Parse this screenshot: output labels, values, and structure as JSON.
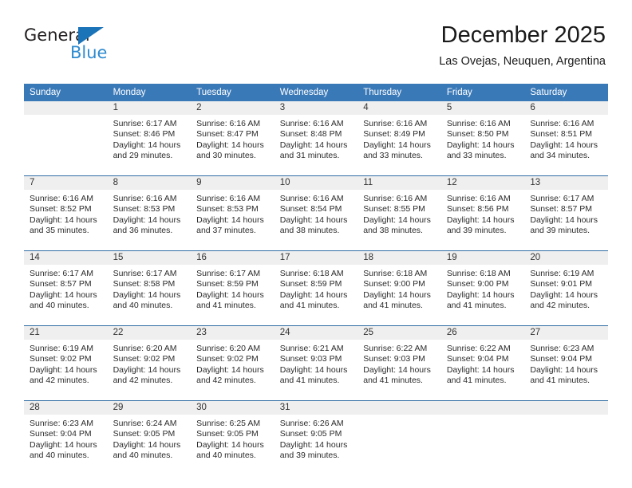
{
  "brand": {
    "name_top": "General",
    "name_bottom": "Blue",
    "accent_color": "#2e8bd0",
    "triangle_color": "#1b73b8"
  },
  "header": {
    "title": "December 2025",
    "subtitle": "Las Ovejas, Neuquen, Argentina"
  },
  "calendar": {
    "header_bg": "#3a79b8",
    "daynum_bg": "#efefef",
    "weekday_headers": [
      "Sunday",
      "Monday",
      "Tuesday",
      "Wednesday",
      "Thursday",
      "Friday",
      "Saturday"
    ],
    "weeks": [
      [
        {
          "day": "",
          "sunrise": "",
          "sunset": "",
          "daylight_line1": "",
          "daylight_line2": ""
        },
        {
          "day": "1",
          "sunrise": "Sunrise: 6:17 AM",
          "sunset": "Sunset: 8:46 PM",
          "daylight_line1": "Daylight: 14 hours",
          "daylight_line2": "and 29 minutes."
        },
        {
          "day": "2",
          "sunrise": "Sunrise: 6:16 AM",
          "sunset": "Sunset: 8:47 PM",
          "daylight_line1": "Daylight: 14 hours",
          "daylight_line2": "and 30 minutes."
        },
        {
          "day": "3",
          "sunrise": "Sunrise: 6:16 AM",
          "sunset": "Sunset: 8:48 PM",
          "daylight_line1": "Daylight: 14 hours",
          "daylight_line2": "and 31 minutes."
        },
        {
          "day": "4",
          "sunrise": "Sunrise: 6:16 AM",
          "sunset": "Sunset: 8:49 PM",
          "daylight_line1": "Daylight: 14 hours",
          "daylight_line2": "and 33 minutes."
        },
        {
          "day": "5",
          "sunrise": "Sunrise: 6:16 AM",
          "sunset": "Sunset: 8:50 PM",
          "daylight_line1": "Daylight: 14 hours",
          "daylight_line2": "and 33 minutes."
        },
        {
          "day": "6",
          "sunrise": "Sunrise: 6:16 AM",
          "sunset": "Sunset: 8:51 PM",
          "daylight_line1": "Daylight: 14 hours",
          "daylight_line2": "and 34 minutes."
        }
      ],
      [
        {
          "day": "7",
          "sunrise": "Sunrise: 6:16 AM",
          "sunset": "Sunset: 8:52 PM",
          "daylight_line1": "Daylight: 14 hours",
          "daylight_line2": "and 35 minutes."
        },
        {
          "day": "8",
          "sunrise": "Sunrise: 6:16 AM",
          "sunset": "Sunset: 8:53 PM",
          "daylight_line1": "Daylight: 14 hours",
          "daylight_line2": "and 36 minutes."
        },
        {
          "day": "9",
          "sunrise": "Sunrise: 6:16 AM",
          "sunset": "Sunset: 8:53 PM",
          "daylight_line1": "Daylight: 14 hours",
          "daylight_line2": "and 37 minutes."
        },
        {
          "day": "10",
          "sunrise": "Sunrise: 6:16 AM",
          "sunset": "Sunset: 8:54 PM",
          "daylight_line1": "Daylight: 14 hours",
          "daylight_line2": "and 38 minutes."
        },
        {
          "day": "11",
          "sunrise": "Sunrise: 6:16 AM",
          "sunset": "Sunset: 8:55 PM",
          "daylight_line1": "Daylight: 14 hours",
          "daylight_line2": "and 38 minutes."
        },
        {
          "day": "12",
          "sunrise": "Sunrise: 6:16 AM",
          "sunset": "Sunset: 8:56 PM",
          "daylight_line1": "Daylight: 14 hours",
          "daylight_line2": "and 39 minutes."
        },
        {
          "day": "13",
          "sunrise": "Sunrise: 6:17 AM",
          "sunset": "Sunset: 8:57 PM",
          "daylight_line1": "Daylight: 14 hours",
          "daylight_line2": "and 39 minutes."
        }
      ],
      [
        {
          "day": "14",
          "sunrise": "Sunrise: 6:17 AM",
          "sunset": "Sunset: 8:57 PM",
          "daylight_line1": "Daylight: 14 hours",
          "daylight_line2": "and 40 minutes."
        },
        {
          "day": "15",
          "sunrise": "Sunrise: 6:17 AM",
          "sunset": "Sunset: 8:58 PM",
          "daylight_line1": "Daylight: 14 hours",
          "daylight_line2": "and 40 minutes."
        },
        {
          "day": "16",
          "sunrise": "Sunrise: 6:17 AM",
          "sunset": "Sunset: 8:59 PM",
          "daylight_line1": "Daylight: 14 hours",
          "daylight_line2": "and 41 minutes."
        },
        {
          "day": "17",
          "sunrise": "Sunrise: 6:18 AM",
          "sunset": "Sunset: 8:59 PM",
          "daylight_line1": "Daylight: 14 hours",
          "daylight_line2": "and 41 minutes."
        },
        {
          "day": "18",
          "sunrise": "Sunrise: 6:18 AM",
          "sunset": "Sunset: 9:00 PM",
          "daylight_line1": "Daylight: 14 hours",
          "daylight_line2": "and 41 minutes."
        },
        {
          "day": "19",
          "sunrise": "Sunrise: 6:18 AM",
          "sunset": "Sunset: 9:00 PM",
          "daylight_line1": "Daylight: 14 hours",
          "daylight_line2": "and 41 minutes."
        },
        {
          "day": "20",
          "sunrise": "Sunrise: 6:19 AM",
          "sunset": "Sunset: 9:01 PM",
          "daylight_line1": "Daylight: 14 hours",
          "daylight_line2": "and 42 minutes."
        }
      ],
      [
        {
          "day": "21",
          "sunrise": "Sunrise: 6:19 AM",
          "sunset": "Sunset: 9:02 PM",
          "daylight_line1": "Daylight: 14 hours",
          "daylight_line2": "and 42 minutes."
        },
        {
          "day": "22",
          "sunrise": "Sunrise: 6:20 AM",
          "sunset": "Sunset: 9:02 PM",
          "daylight_line1": "Daylight: 14 hours",
          "daylight_line2": "and 42 minutes."
        },
        {
          "day": "23",
          "sunrise": "Sunrise: 6:20 AM",
          "sunset": "Sunset: 9:02 PM",
          "daylight_line1": "Daylight: 14 hours",
          "daylight_line2": "and 42 minutes."
        },
        {
          "day": "24",
          "sunrise": "Sunrise: 6:21 AM",
          "sunset": "Sunset: 9:03 PM",
          "daylight_line1": "Daylight: 14 hours",
          "daylight_line2": "and 41 minutes."
        },
        {
          "day": "25",
          "sunrise": "Sunrise: 6:22 AM",
          "sunset": "Sunset: 9:03 PM",
          "daylight_line1": "Daylight: 14 hours",
          "daylight_line2": "and 41 minutes."
        },
        {
          "day": "26",
          "sunrise": "Sunrise: 6:22 AM",
          "sunset": "Sunset: 9:04 PM",
          "daylight_line1": "Daylight: 14 hours",
          "daylight_line2": "and 41 minutes."
        },
        {
          "day": "27",
          "sunrise": "Sunrise: 6:23 AM",
          "sunset": "Sunset: 9:04 PM",
          "daylight_line1": "Daylight: 14 hours",
          "daylight_line2": "and 41 minutes."
        }
      ],
      [
        {
          "day": "28",
          "sunrise": "Sunrise: 6:23 AM",
          "sunset": "Sunset: 9:04 PM",
          "daylight_line1": "Daylight: 14 hours",
          "daylight_line2": "and 40 minutes."
        },
        {
          "day": "29",
          "sunrise": "Sunrise: 6:24 AM",
          "sunset": "Sunset: 9:05 PM",
          "daylight_line1": "Daylight: 14 hours",
          "daylight_line2": "and 40 minutes."
        },
        {
          "day": "30",
          "sunrise": "Sunrise: 6:25 AM",
          "sunset": "Sunset: 9:05 PM",
          "daylight_line1": "Daylight: 14 hours",
          "daylight_line2": "and 40 minutes."
        },
        {
          "day": "31",
          "sunrise": "Sunrise: 6:26 AM",
          "sunset": "Sunset: 9:05 PM",
          "daylight_line1": "Daylight: 14 hours",
          "daylight_line2": "and 39 minutes."
        },
        {
          "day": "",
          "sunrise": "",
          "sunset": "",
          "daylight_line1": "",
          "daylight_line2": ""
        },
        {
          "day": "",
          "sunrise": "",
          "sunset": "",
          "daylight_line1": "",
          "daylight_line2": ""
        },
        {
          "day": "",
          "sunrise": "",
          "sunset": "",
          "daylight_line1": "",
          "daylight_line2": ""
        }
      ]
    ]
  }
}
